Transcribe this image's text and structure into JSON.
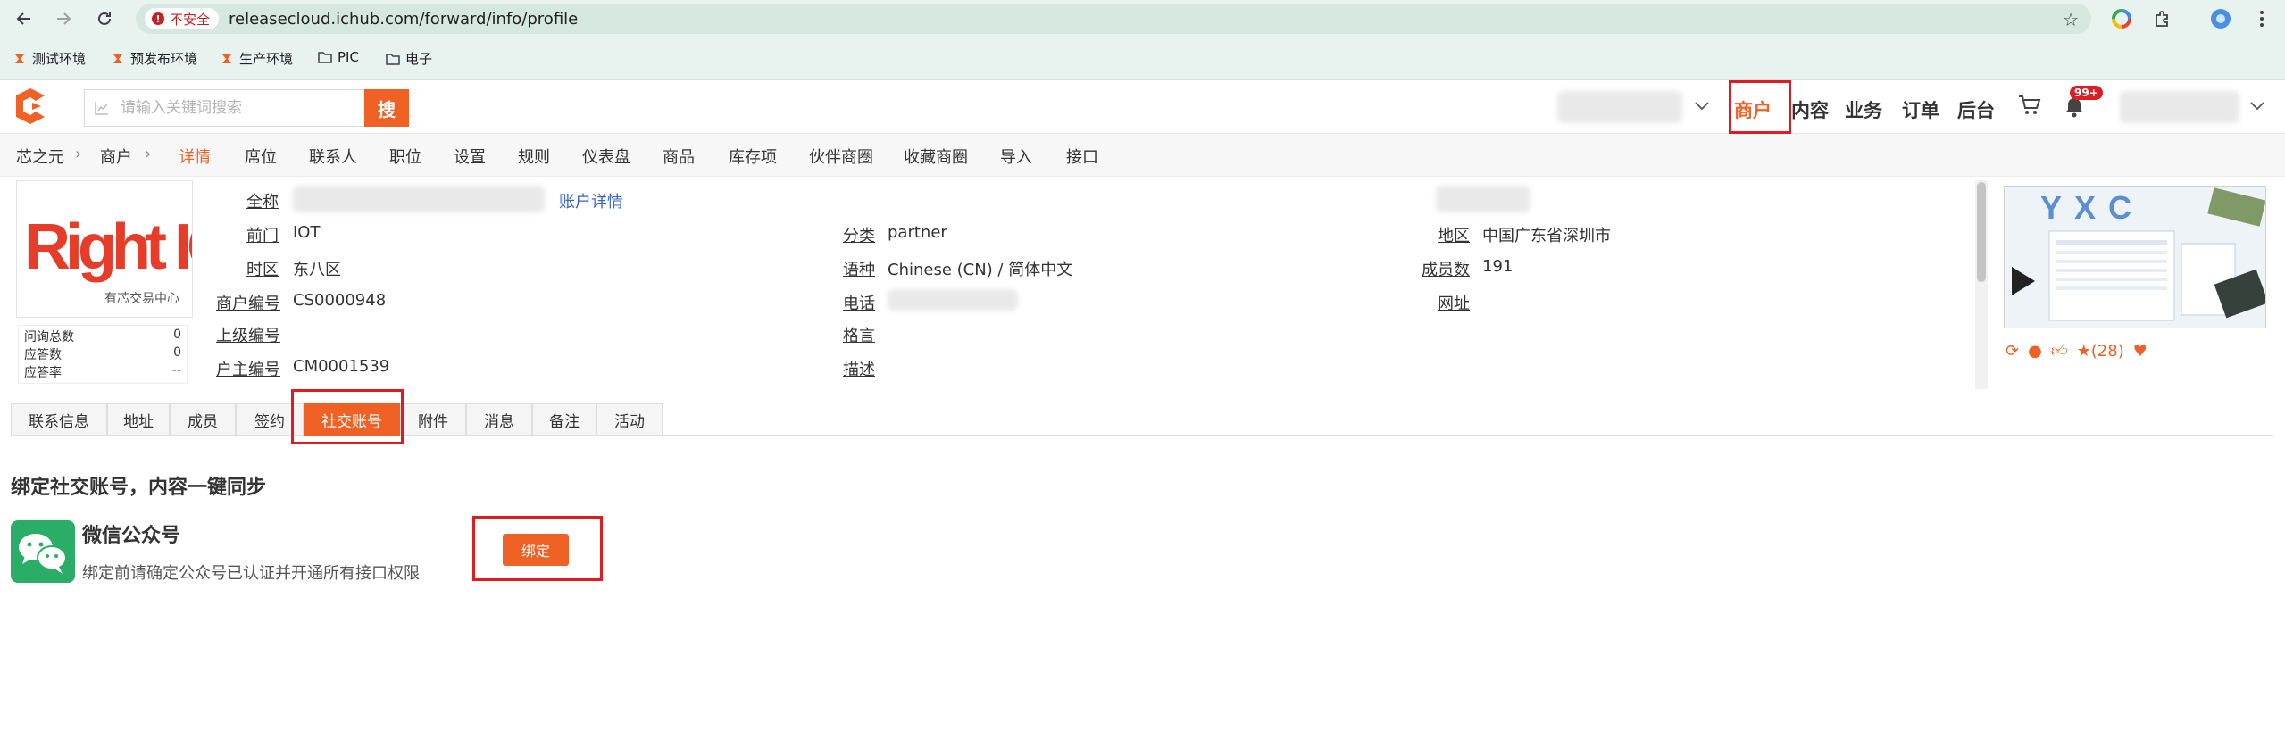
{
  "browser": {
    "security_label": "不安全",
    "url": "releasecloud.ichub.com/forward/info/profile",
    "bookmarks": [
      {
        "label": "测试环境",
        "icon": "app-logo-icon"
      },
      {
        "label": "预发布环境",
        "icon": "app-logo-icon"
      },
      {
        "label": "生产环境",
        "icon": "app-logo-icon"
      },
      {
        "label": "PIC",
        "icon": "folder-icon"
      },
      {
        "label": "电子",
        "icon": "folder-icon"
      }
    ]
  },
  "header": {
    "search_placeholder": "请输入关键词搜索",
    "search_button": "搜",
    "menu": [
      "商户",
      "内容",
      "业务",
      "订单",
      "后台"
    ],
    "notification_count": "99+",
    "accent_color": "#ef6125"
  },
  "subnav": {
    "breadcrumb": [
      "芯之元",
      "商户"
    ],
    "items": [
      "详情",
      "席位",
      "联系人",
      "职位",
      "设置",
      "规则",
      "仪表盘",
      "商品",
      "库存项",
      "伙伴商圈",
      "收藏商圈",
      "导入",
      "接口"
    ],
    "active": "详情"
  },
  "profile": {
    "logo_text": "Right IC",
    "logo_subtext": "有芯交易中心",
    "stats": [
      {
        "label": "问询总数",
        "value": "0"
      },
      {
        "label": "应答数",
        "value": "0"
      },
      {
        "label": "应答率",
        "value": "--"
      }
    ],
    "fields": {
      "full_name_label": "全称",
      "account_detail_link": "账户详情",
      "frontdoor_label": "前门",
      "frontdoor_value": "IOT",
      "timezone_label": "时区",
      "timezone_value": "东八区",
      "merchant_no_label": "商户编号",
      "merchant_no_value": "CS0000948",
      "parent_no_label": "上级编号",
      "owner_no_label": "户主编号",
      "owner_no_value": "CM0001539",
      "category_label": "分类",
      "category_value": "partner",
      "language_label": "语种",
      "language_value": "Chinese (CN) / 简体中文",
      "phone_label": "电话",
      "motto_label": "格言",
      "desc_label": "描述",
      "region_label": "地区",
      "region_value": "中国广东省深圳市",
      "members_label": "成员数",
      "members_value": "191",
      "website_label": "网址"
    },
    "preview_banner_text": "YXC",
    "star_count": "(28)"
  },
  "tabs": {
    "items": [
      "联系信息",
      "地址",
      "成员",
      "签约",
      "社交账号",
      "附件",
      "消息",
      "备注",
      "活动"
    ],
    "active": "社交账号"
  },
  "social": {
    "title": "绑定社交账号，内容一键同步",
    "wechat_name": "微信公众号",
    "wechat_desc": "绑定前请确定公众号已认证并开通所有接口权限",
    "bind_button": "绑定"
  }
}
